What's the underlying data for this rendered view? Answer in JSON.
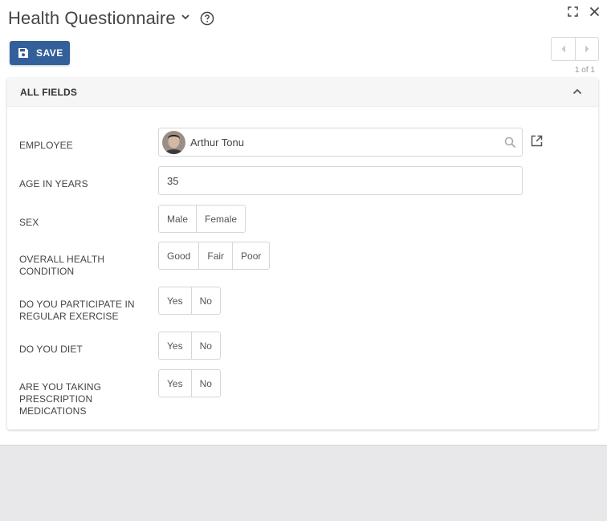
{
  "window": {
    "title": "Health Questionnaire",
    "icons": {
      "dropdown": "chevron-down-icon",
      "help": "help-circle-icon",
      "fullscreen": "fullscreen-icon",
      "close": "close-icon"
    }
  },
  "toolbar": {
    "save_label": "SAVE",
    "save_icon": "floppy-disk-icon",
    "accent": "#33609a"
  },
  "pager": {
    "text": "1 of 1",
    "prev_icon": "chevron-left-icon",
    "next_icon": "chevron-right-icon"
  },
  "section": {
    "title": "ALL FIELDS",
    "collapse_icon": "chevron-up-icon",
    "fields": {
      "employee": {
        "label": "EMPLOYEE",
        "value": "Arthur Tonu"
      },
      "age": {
        "label": "AGE IN YEARS",
        "value": "35"
      },
      "sex": {
        "label": "SEX",
        "options": [
          "Male",
          "Female"
        ]
      },
      "health": {
        "label": "OVERALL HEALTH CONDITION",
        "options": [
          "Good",
          "Fair",
          "Poor"
        ]
      },
      "exercise": {
        "label": "DO YOU PARTICIPATE IN REGULAR EXERCISE",
        "options": [
          "Yes",
          "No"
        ]
      },
      "diet": {
        "label": "DO YOU DIET",
        "options": [
          "Yes",
          "No"
        ]
      },
      "medications": {
        "label": "ARE YOU TAKING PRESCRIPTION MEDICATIONS",
        "options": [
          "Yes",
          "No"
        ]
      }
    }
  }
}
